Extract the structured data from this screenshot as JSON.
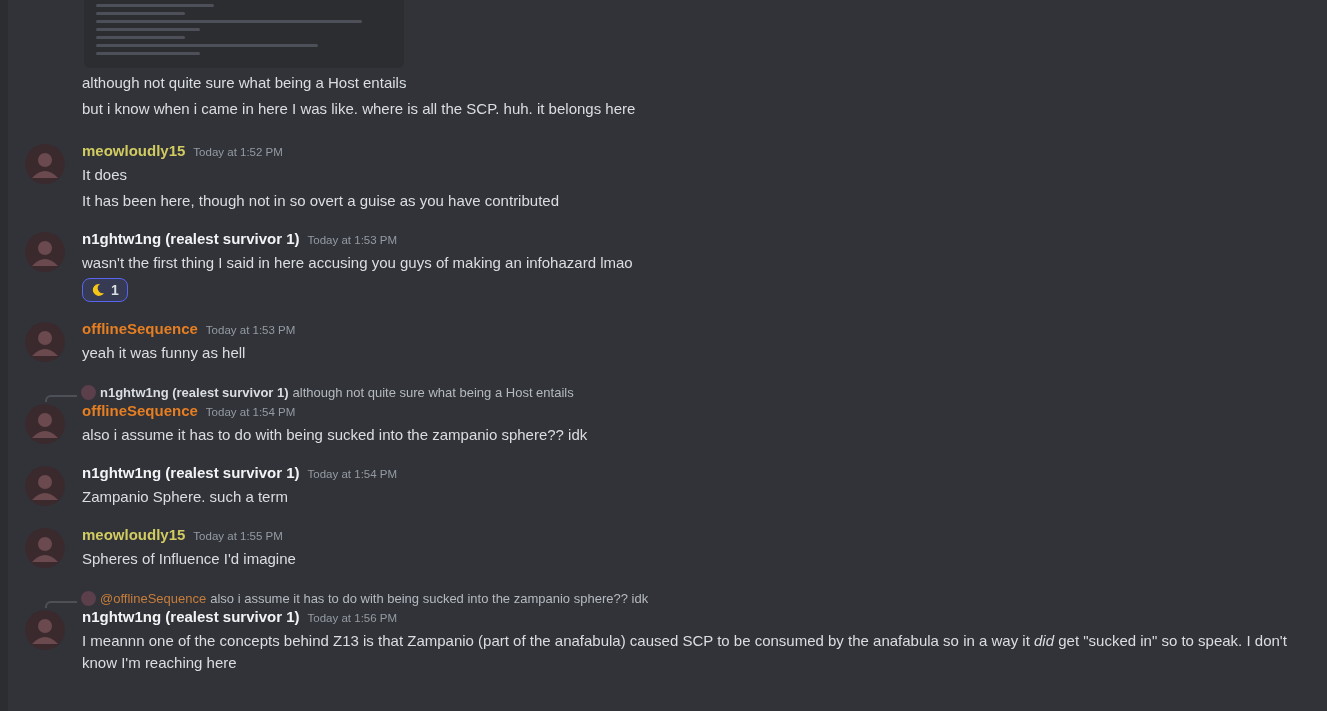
{
  "intro": {
    "lines": [
      "although not quite sure what being a Host entails",
      "but i know when i came in here I  was like. where is all the SCP. huh. it belongs here"
    ]
  },
  "messages": [
    {
      "author": "meowloudly15",
      "color": "#d1cb61",
      "timestamp": "Today at 1:52 PM",
      "lines": [
        "It does",
        "It has been here, though not in so overt a guise as you have contributed"
      ]
    },
    {
      "author": "n1ghtw1ng (realest survivor 1)",
      "color": "#f2f3f5",
      "timestamp": "Today at 1:53 PM",
      "lines": [
        "wasn't the first thing I said in here accusing you guys of making an infohazard lmao"
      ],
      "reactions": [
        {
          "count": "1",
          "selected": true
        }
      ]
    },
    {
      "author": "offlineSequence",
      "color": "#e67e22",
      "timestamp": "Today at 1:53 PM",
      "lines": [
        "yeah it was funny as hell"
      ]
    },
    {
      "reply": {
        "author": "n1ghtw1ng (realest survivor 1)",
        "mention": false,
        "text": "although not quite sure what being a Host entails"
      },
      "author": "offlineSequence",
      "color": "#e67e22",
      "timestamp": "Today at 1:54 PM",
      "lines": [
        "also i assume it has to do with being sucked into the zampanio sphere?? idk"
      ]
    },
    {
      "author": "n1ghtw1ng (realest survivor 1)",
      "color": "#f2f3f5",
      "timestamp": "Today at 1:54 PM",
      "lines": [
        "Zampanio Sphere. such a term"
      ]
    },
    {
      "author": "meowloudly15",
      "color": "#d1cb61",
      "timestamp": "Today at 1:55 PM",
      "lines": [
        "Spheres of Influence I'd imagine"
      ]
    },
    {
      "reply": {
        "author": "@offlineSequence",
        "mention": true,
        "text": "also i assume it has to do with being sucked into the zampanio sphere?? idk"
      },
      "author": "n1ghtw1ng (realest survivor 1)",
      "color": "#f2f3f5",
      "timestamp": "Today at 1:56 PM",
      "lines": [
        "I meannn one of the concepts behind Z13 is that Zampanio (part of the anafabula) caused SCP to be consumed by the anafabula so in a way it *did* get \"sucked in\" so to speak. I don't know I'm reaching here"
      ]
    }
  ]
}
